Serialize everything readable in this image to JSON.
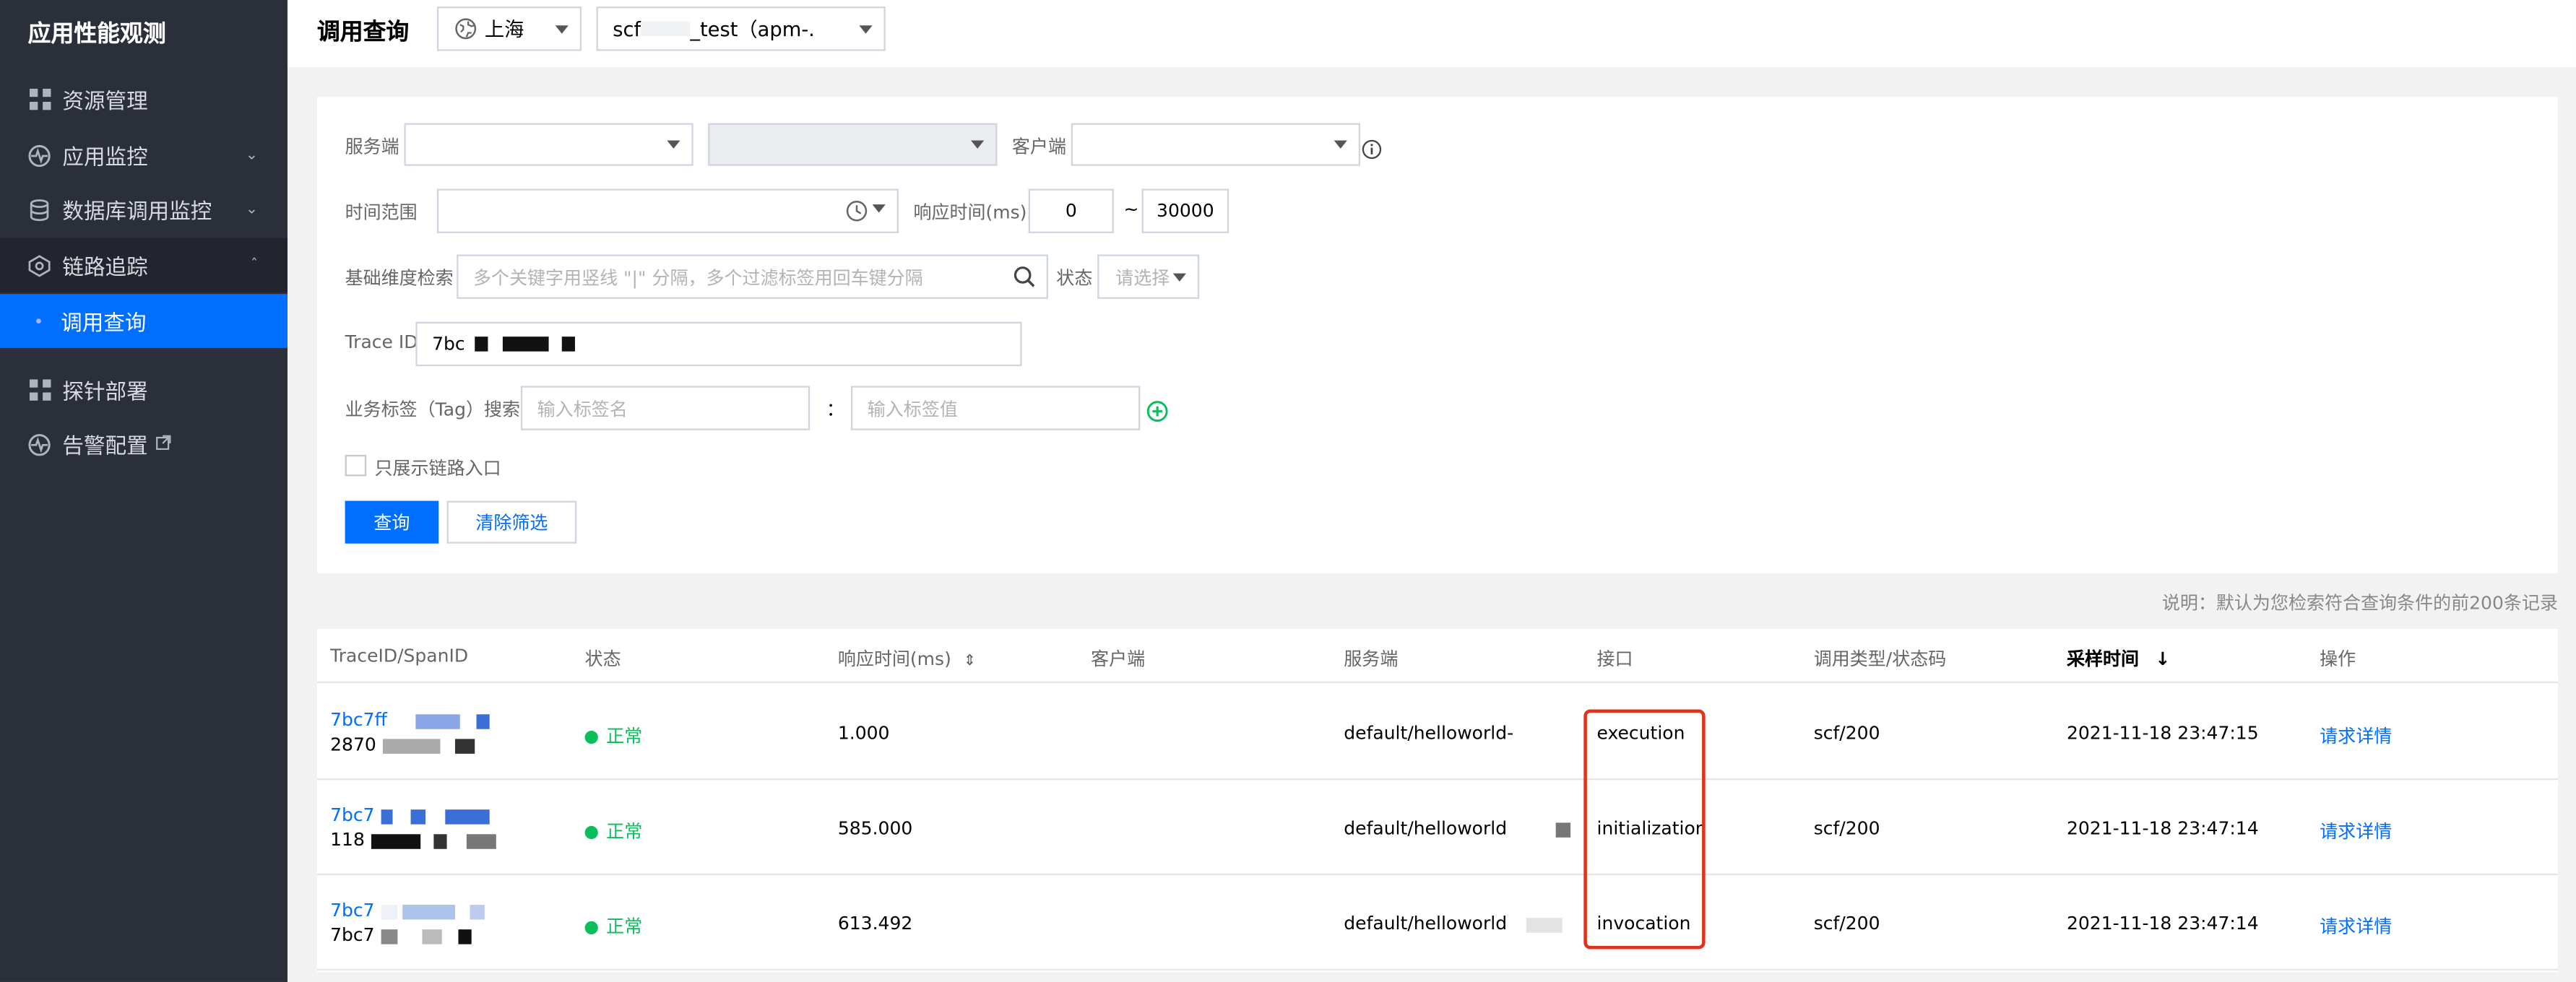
{
  "app": {
    "title": "应用性能观测"
  },
  "sidebar": {
    "items": [
      {
        "label": "资源管理"
      },
      {
        "label": "应用监控"
      },
      {
        "label": "数据库调用监控"
      },
      {
        "label": "链路追踪"
      },
      {
        "label": "调用查询"
      },
      {
        "label": "探针部署"
      },
      {
        "label": "告警配置"
      }
    ]
  },
  "header": {
    "title": "调用查询",
    "region": "上海",
    "instance_prefix": "scf",
    "instance_suffix": "_test（apm-."
  },
  "filters": {
    "server_label": "服务端",
    "client_label": "客户端",
    "time_label": "时间范围",
    "resp_label": "响应时间(ms)",
    "resp_min": "0",
    "resp_sep": "~",
    "resp_max": "30000",
    "basic_label": "基础维度检索",
    "basic_placeholder": "多个关键字用竖线 \"|\" 分隔，多个过滤标签用回车键分隔",
    "status_label": "状态",
    "status_placeholder": "请选择",
    "trace_label": "Trace ID",
    "trace_value": "7bc",
    "tag_label": "业务标签（Tag）搜索：",
    "tag_key_placeholder": "输入标签名",
    "tag_colon": "：",
    "tag_value_placeholder": "输入标签值",
    "entry_only_label": "只展示链路入口",
    "query_button": "查询",
    "clear_button": "清除筛选"
  },
  "note": "说明：默认为您检索符合查询条件的前200条记录",
  "table": {
    "headers": {
      "trace": "TraceID/SpanID",
      "status": "状态",
      "resp": "响应时间(ms)",
      "client": "客户端",
      "server": "服务端",
      "iface": "接口",
      "type": "调用类型/状态码",
      "time": "采样时间",
      "op": "操作"
    },
    "rows": [
      {
        "trace": "7bc7ff",
        "span": "2870",
        "status": "正常",
        "resp": "1.000",
        "server": "default/helloworld-",
        "iface": "execution",
        "type": "scf/200",
        "time": "2021-11-18 23:47:15",
        "op": "请求详情"
      },
      {
        "trace": "7bc7",
        "span": "118",
        "status": "正常",
        "resp": "585.000",
        "server": "default/helloworld",
        "iface": "initialization",
        "type": "scf/200",
        "time": "2021-11-18 23:47:14",
        "op": "请求详情"
      },
      {
        "trace": "7bc7",
        "span": "7bc7",
        "status": "正常",
        "resp": "613.492",
        "server": "default/helloworld",
        "iface": "invocation",
        "type": "scf/200",
        "time": "2021-11-18 23:47:14",
        "op": "请求详情"
      }
    ]
  }
}
